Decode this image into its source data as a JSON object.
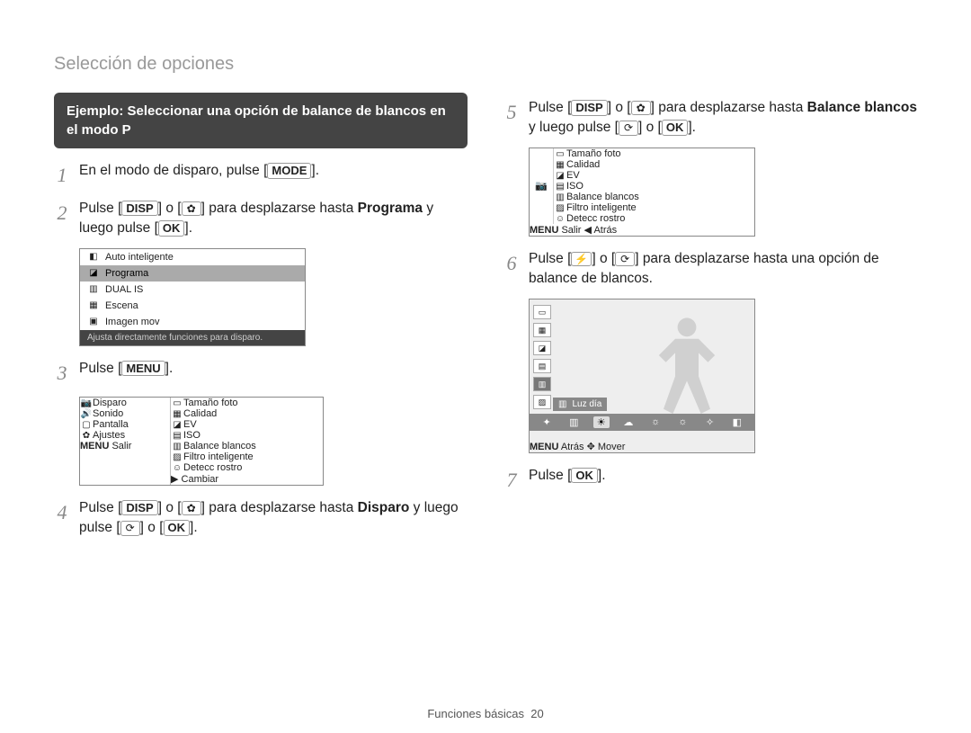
{
  "header": "Selección de opciones",
  "example": "Ejemplo: Seleccionar una opción de balance de blancos en el modo P",
  "steps": {
    "s1_a": "En el modo de disparo, pulse [",
    "s1_mode": "MODE",
    "s1_b": "].",
    "s2_a": "Pulse [",
    "s2_disp": "DISP",
    "s2_b": "] o [",
    "s2_c": "] para desplazarse hasta ",
    "s2_prog": "Programa",
    "s2_d": " y luego pulse [",
    "s2_ok": "OK",
    "s2_e": "].",
    "s3_a": "Pulse [",
    "s3_menu": "MENU",
    "s3_b": "].",
    "s4_a": "Pulse [",
    "s4_disp": "DISP",
    "s4_b": "] o [",
    "s4_c": "] para desplazarse hasta ",
    "s4_disparo": "Disparo",
    "s4_d": " y luego pulse [",
    "s4_e": "] o [",
    "s4_ok": "OK",
    "s4_f": "].",
    "s5_a": "Pulse [",
    "s5_disp": "DISP",
    "s5_b": "] o [",
    "s5_c": "] para desplazarse hasta ",
    "s5_bb": "Balance blancos",
    "s5_d": " y luego pulse [",
    "s5_e": "] o [",
    "s5_ok": "OK",
    "s5_f": "].",
    "s6_a": "Pulse [",
    "s6_b": "] o [",
    "s6_c": "] para desplazarse hasta una opción de balance de blancos.",
    "s7_a": "Pulse [",
    "s7_ok": "OK",
    "s7_b": "]."
  },
  "shot1": {
    "items": [
      "Auto inteligente",
      "Programa",
      "DUAL IS",
      "Escena",
      "Imagen mov"
    ],
    "hint": "Ajusta directamente funciones para disparo."
  },
  "shot2": {
    "left": [
      "Disparo",
      "Sonido",
      "Pantalla",
      "Ajustes"
    ],
    "right": [
      "Tamaño foto",
      "Calidad",
      "EV",
      "ISO",
      "Balance blancos",
      "Filtro inteligente",
      "Detecc rostro"
    ],
    "footer_left_label": "Salir",
    "footer_left_key": "MENU",
    "footer_right": "Cambiar"
  },
  "shot3": {
    "items": [
      "Tamaño foto",
      "Calidad",
      "EV",
      "ISO",
      "Balance blancos",
      "Filtro inteligente",
      "Detecc rostro"
    ],
    "footer_left_label": "Salir",
    "footer_left_key": "MENU",
    "footer_right": "Atrás"
  },
  "shot4": {
    "label": "Luz día",
    "footer_left_key": "MENU",
    "footer_left_label": "Atrás",
    "footer_right": "Mover"
  },
  "footer": {
    "section": "Funciones básicas",
    "page": "20"
  }
}
